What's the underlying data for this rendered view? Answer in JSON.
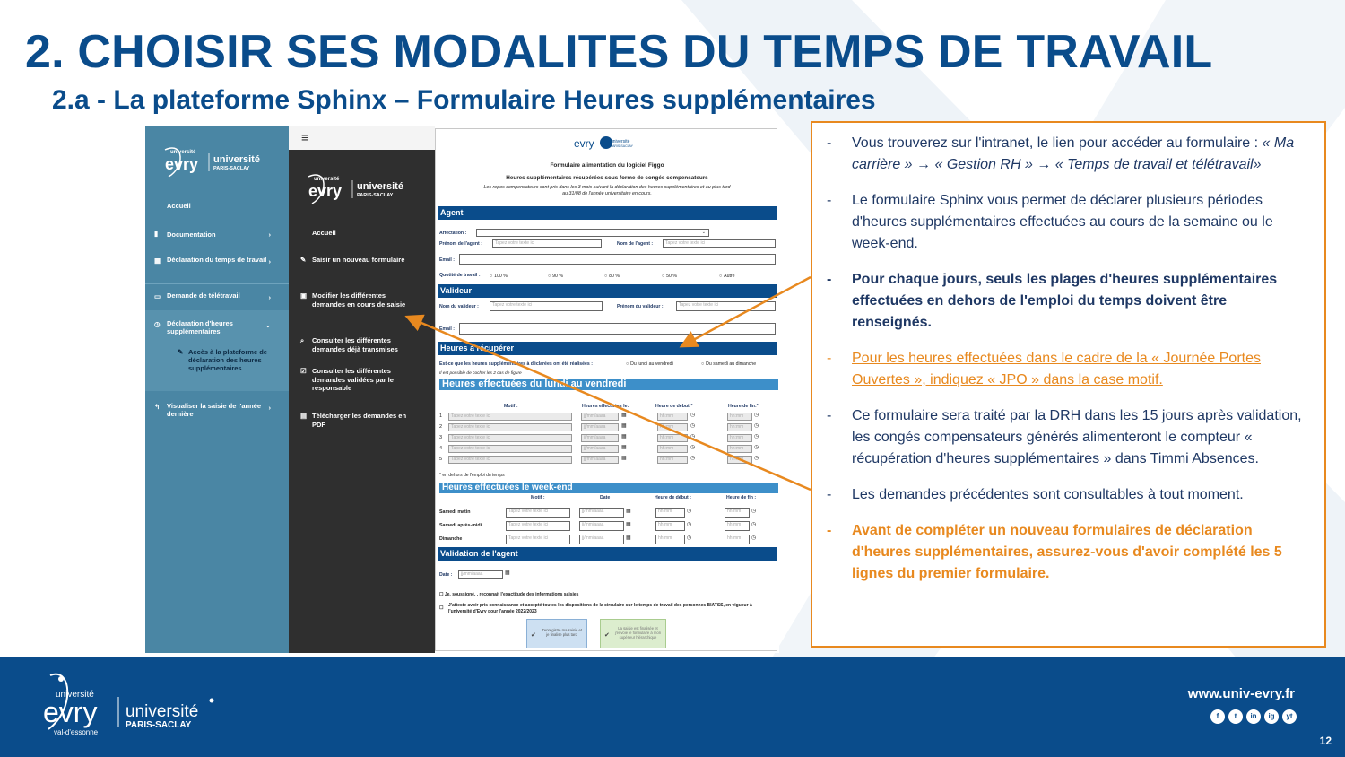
{
  "slide": {
    "title": "2. CHOISIR SES MODALITES DU TEMPS DE TRAVAIL",
    "subtitle": "2.a - La plateforme Sphinx – Formulaire Heures supplémentaires",
    "page_number": "12"
  },
  "left_sidebar": {
    "items": [
      {
        "label": "Accueil"
      },
      {
        "label": "Documentation"
      },
      {
        "label": "Déclaration du temps de travail"
      },
      {
        "label": "Demande de télétravail"
      },
      {
        "label": "Déclaration d'heures supplémentaires"
      },
      {
        "label": "Visualiser la saisie de l'année dernière"
      }
    ],
    "sub_item": "Accès à la plateforme de déclaration des heures supplémentaires"
  },
  "mid_sidebar": {
    "menu_icon": "≡",
    "items": [
      {
        "label": "Accueil"
      },
      {
        "label": "Saisir un nouveau formulaire"
      },
      {
        "label": "Modifier les différentes demandes en cours de saisie"
      },
      {
        "label": "Consulter les différentes demandes déjà transmises"
      },
      {
        "label": "Consulter les différentes demandes validées par le responsable"
      },
      {
        "label": "Télécharger les demandes en PDF"
      }
    ]
  },
  "form": {
    "title": "Formulaire alimentation du logiciel Figgo",
    "heading": "Heures supplémentaires récupérées sous forme de congés compensateurs",
    "note": "Les repos compensateurs sont pris dans les 3 mois suivant la déclaration des heures supplémentaires et au plus tard au 31/08 de l'année universitaire en cours.",
    "placeholder": "Tapez votre texte ici",
    "date_placeholder": "jj/mm/aaaa",
    "time_placeholder": "hh:mm",
    "agent": {
      "section": "Agent",
      "affectation": "Affectation :",
      "prenom": "Prénom de l'agent :",
      "nom": "Nom de l'agent :",
      "email": "Email :",
      "quotite": "Quotité de travail :",
      "options": [
        "100 %",
        "90 %",
        "80 %",
        "50 %",
        "Autre"
      ]
    },
    "valideur": {
      "section": "Valideur",
      "nom": "Nom du valideur :",
      "prenom": "Prénom du valideur :",
      "email": "Email :"
    },
    "recup": {
      "section": "Heures à récupérer",
      "question": "Est-ce que les heures supplémentaires à déclarées ont été réalisées :",
      "opt1": "Du lundi au vendredi",
      "opt2": "Du samedi au dimanche",
      "hint": "Il est possible de cocher les 2 cas de figure"
    },
    "weekday": {
      "section": "Heures effectuées du lundi au vendredi",
      "cols": [
        "Motif :",
        "Heures effectuées le:",
        "Heure de début:*",
        "Heure de fin:*"
      ],
      "rows": [
        "1",
        "2",
        "3",
        "4",
        "5"
      ],
      "footnote": "* en dehors de l'emploi du temps"
    },
    "weekend": {
      "section": "Heures effectuées le week-end",
      "cols": [
        "Motif :",
        "Date :",
        "Heure de début :",
        "Heure de fin :"
      ],
      "rows": [
        "Samedi matin",
        "Samedi après-midi",
        "Dimanche"
      ]
    },
    "validation": {
      "section": "Validation de l'agent",
      "date": "Date :",
      "check1": "Je, soussigné, , reconnait l'exactitude des informations saisies",
      "check2": "J'atteste avoir pris connaissance et accepté toutes les dispositions de la circulaire sur le temps de travail des personnes BIATSS, en vigueur à l'université d'Evry pour l'année 2022/2023",
      "btn1": "J'enregistre ma saisie et je finalise plus tard",
      "btn2": "La saisie est finalisée et j'envoie le formulaire à mon supérieur hiérarchique"
    }
  },
  "panel": {
    "b1_a": "Vous trouverez sur l'intranet, le lien pour accéder au formulaire : ",
    "b1_b": "« Ma carrière » → « Gestion RH » → « Temps  de travail et télétravail»",
    "b2": "Le formulaire Sphinx vous permet de déclarer plusieurs périodes d'heures supplémentaires effectuées au cours de la semaine ou le week-end.",
    "b3": "Pour chaque jours, seuls les plages d'heures supplémentaires effectuées en dehors de l'emploi du temps doivent être renseignés.",
    "b4": "Pour les heures effectuées dans le cadre de la « Journée Portes Ouvertes », indiquez « JPO » dans la case motif.",
    "b5": "Ce formulaire sera traité par la DRH dans les 15 jours après validation, les congés compensateurs générés alimenteront le compteur « récupération d'heures supplémentaires » dans Timmi Absences.",
    "b6": "Les demandes précédentes sont consultables à tout moment.",
    "b7": "Avant de compléter un nouveau formulaires de déclaration d'heures supplémentaires, assurez-vous d'avoir complété les 5 lignes du premier formulaire."
  },
  "footer": {
    "url": "www.univ-evry.fr",
    "social": [
      "f",
      "t",
      "in",
      "ig",
      "yt"
    ]
  },
  "logos": {
    "evry_small": "université",
    "evry_name": "evry",
    "evry_place": "val-d'essonne",
    "saclay_1": "université",
    "saclay_2": "PARIS-SACLAY"
  },
  "colors": {
    "brand_blue": "#0a4c8b",
    "accent_orange": "#e8891f",
    "sidebar_blue": "#4a86a4",
    "sidebar_dark": "#2f2f2f"
  }
}
